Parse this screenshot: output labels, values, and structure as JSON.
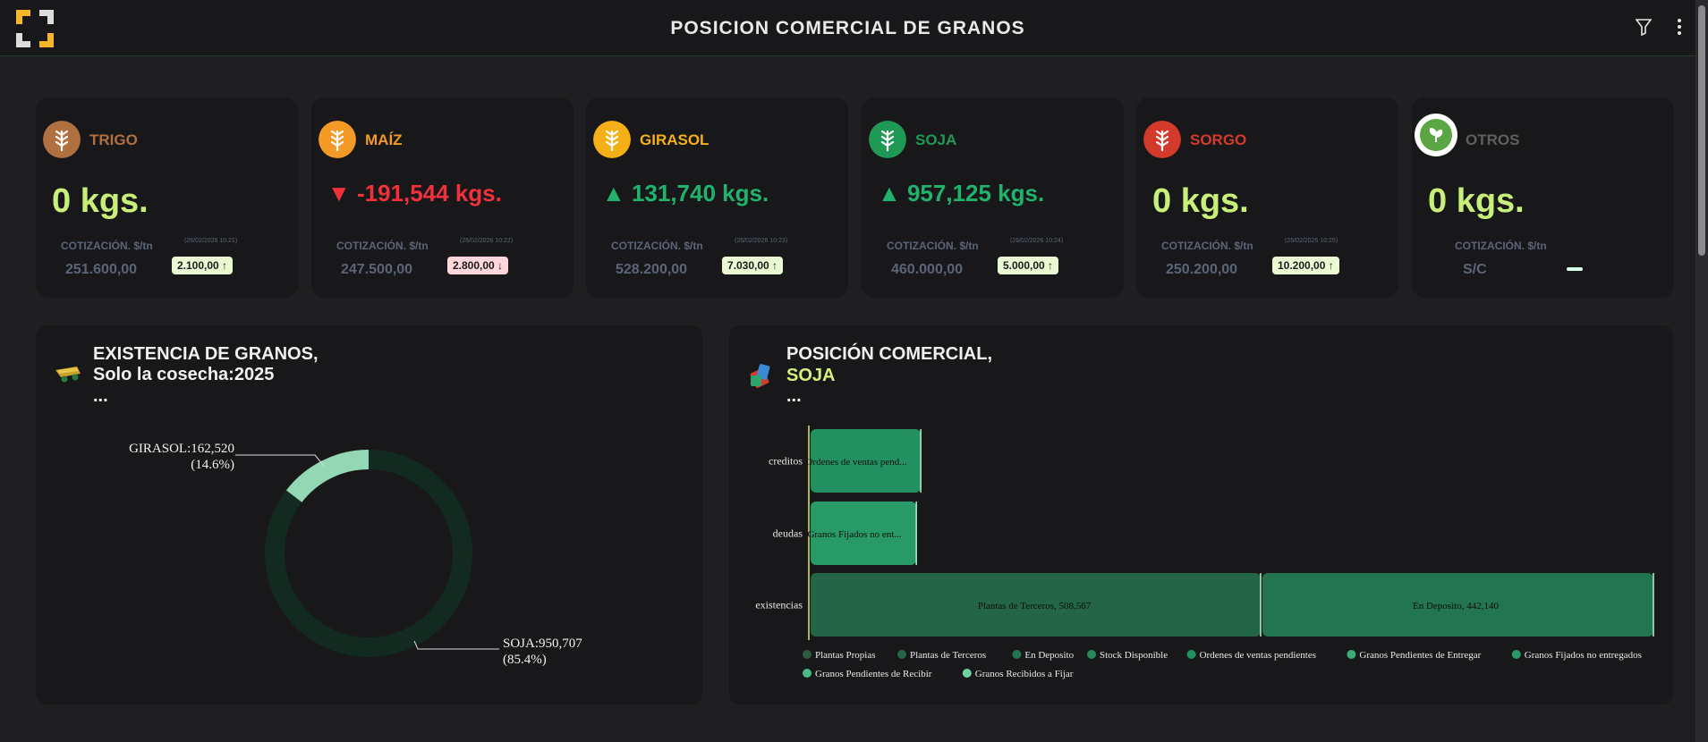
{
  "header": {
    "title": "POSICION COMERCIAL DE GRANOS",
    "logo_icon": "bracket-logo",
    "filter_icon": "filter-icon",
    "menu_icon": "kebab-menu-icon"
  },
  "cards": [
    {
      "name": "TRIGO",
      "color": "#b0703f",
      "icon": "wheat-icon",
      "amount": "0 kgs.",
      "arrow": "",
      "cot_label": "COTIZACIÓN. $/tn",
      "cot_date": "(26/02/2026 10:21)",
      "price": "251.600,00",
      "badge": "2.100,00 ↑",
      "badge_type": "up"
    },
    {
      "name": "MAÍZ",
      "color": "#f39a26",
      "icon": "corn-icon",
      "amount": "▼ -191,544 kgs.",
      "arrow": "down",
      "cot_label": "COTIZACIÓN. $/tn",
      "cot_date": "(26/02/2026 10:22)",
      "price": "247.500,00",
      "badge": "2.800,00 ↓",
      "badge_type": "down"
    },
    {
      "name": "GIRASOL",
      "color": "#f5b018",
      "icon": "sunflower-icon",
      "amount": "▲ 131,740 kgs.",
      "arrow": "up",
      "cot_label": "COTIZACIÓN. $/tn",
      "cot_date": "(26/02/2026 10:23)",
      "price": "528.200,00",
      "badge": "7.030,00 ↑",
      "badge_type": "up"
    },
    {
      "name": "SOJA",
      "color": "#1f9a54",
      "icon": "soy-icon",
      "amount": "▲ 957,125 kgs.",
      "arrow": "up",
      "cot_label": "COTIZACIÓN. $/tn",
      "cot_date": "(26/02/2026 10:24)",
      "price": "460.000,00",
      "badge": "5.000,00 ↑",
      "badge_type": "up"
    },
    {
      "name": "SORGO",
      "color": "#d23a2c",
      "icon": "sorghum-icon",
      "amount": "0 kgs.",
      "arrow": "",
      "cot_label": "COTIZACIÓN. $/tn",
      "cot_date": "(26/02/2026 10:25)",
      "price": "250.200,00",
      "badge": "10.200,00 ↑",
      "badge_type": "up"
    },
    {
      "name": "OTROS",
      "color": "#5f5f60",
      "icon": "leaf-icon",
      "amount": "0 kgs.",
      "arrow": "",
      "cot_label": "COTIZACIÓN. $/tn",
      "cot_date": "",
      "price": "S/C",
      "badge": "",
      "badge_type": "none"
    }
  ],
  "existencia": {
    "icon": "grain-cart-icon",
    "title1": "EXISTENCIA DE GRANOS,",
    "title2": "Solo la cosecha:2025",
    "ellipsis": "..."
  },
  "posicion": {
    "icon": "ticket-icon",
    "title1": "POSICIÓN COMERCIAL,",
    "title2": "SOJA",
    "ellipsis": "..."
  },
  "colors": {
    "amount_zero": "#c8ef7a",
    "down": "#f0313c",
    "up": "#21b26b",
    "accent_title": "#d5f07c"
  },
  "chart_data": [
    {
      "type": "pie",
      "subtype": "donut",
      "categories": [
        "GIRASOL",
        "SOJA"
      ],
      "values": [
        162520,
        950707
      ],
      "labels": [
        "GIRASOL:162,520",
        "SOJA:950,707"
      ],
      "percent_labels": [
        "(14.6%)",
        "(85.4%)"
      ],
      "colors": [
        "#93d8b5",
        "#122a1f"
      ]
    },
    {
      "type": "bar",
      "orientation": "horizontal",
      "stacked": true,
      "categories": [
        "creditos",
        "deudas",
        "existencias"
      ],
      "series": [
        {
          "name": "Plantas Propias",
          "values": [
            0,
            0,
            0
          ],
          "color": "#2e5b43"
        },
        {
          "name": "Plantas de Terceros",
          "values": [
            0,
            0,
            508567
          ],
          "color": "#236546"
        },
        {
          "name": "En Deposito",
          "values": [
            0,
            0,
            442140
          ],
          "color": "#237450"
        },
        {
          "name": "Stock Disponible",
          "values": [
            0,
            0,
            0
          ],
          "color": "#2a8758"
        },
        {
          "name": "Ordenes de ventas pendientes",
          "values": [
            126000,
            0,
            0
          ],
          "color": "#229060"
        },
        {
          "name": "Granos Pendientes de Entregar",
          "values": [
            0,
            0,
            0
          ],
          "color": "#3bac77"
        },
        {
          "name": "Granos Fijados no entregados",
          "values": [
            0,
            121000,
            0
          ],
          "color": "#279a67"
        },
        {
          "name": "Granos Pendientes de Recibir",
          "values": [
            0,
            0,
            0
          ],
          "color": "#4cba86"
        },
        {
          "name": "Granos Recibidos a Fijar",
          "values": [
            0,
            0,
            0
          ],
          "color": "#6fd0a0"
        }
      ],
      "bar_labels": [
        "Ordenes de ventas pend...",
        "Granos Fijados no ent...",
        "Plantas de Terceros, 508,567",
        "En Deposito, 442,140"
      ],
      "legend_position": "bottom"
    }
  ]
}
